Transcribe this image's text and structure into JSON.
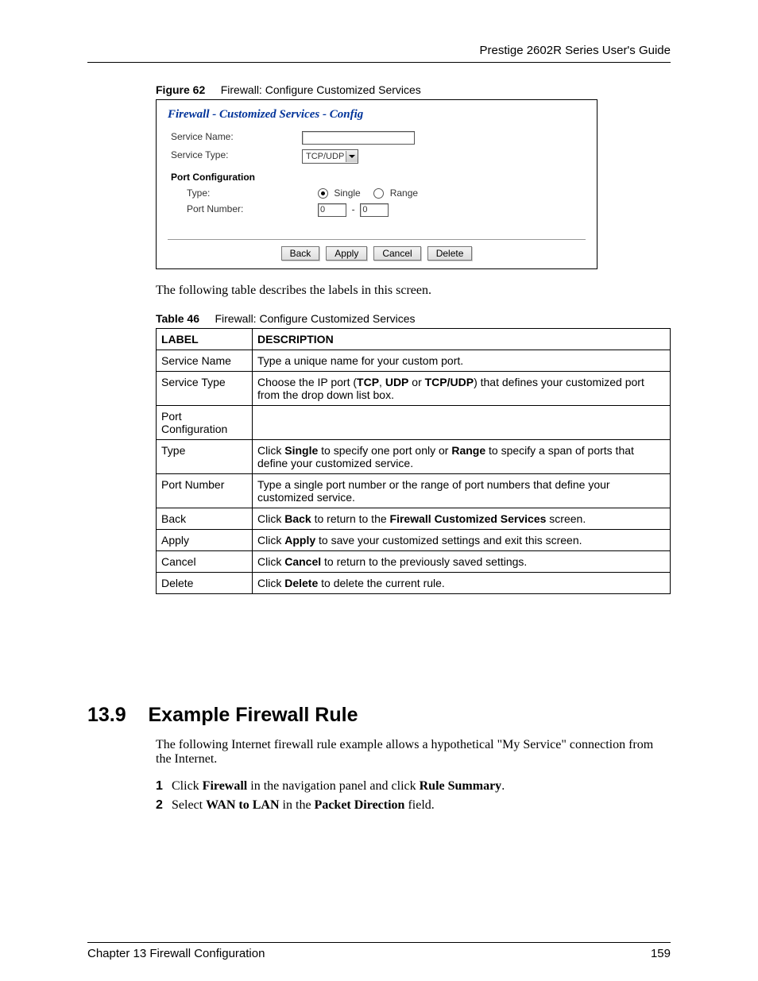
{
  "header": {
    "guide_title": "Prestige 2602R Series User's Guide"
  },
  "figure": {
    "label": "Figure 62",
    "title": "Firewall: Configure Customized Services",
    "panel_title": "Firewall - Customized Services - Config",
    "service_name_label": "Service Name:",
    "service_name_value": "",
    "service_type_label": "Service Type:",
    "service_type_value": "TCP/UDP",
    "port_config_heading": "Port Configuration",
    "type_label": "Type:",
    "type_single": "Single",
    "type_range": "Range",
    "port_number_label": "Port Number:",
    "port_from": "0",
    "port_dash": "-",
    "port_to": "0",
    "buttons": {
      "back": "Back",
      "apply": "Apply",
      "cancel": "Cancel",
      "delete": "Delete"
    }
  },
  "intro_text": "The following table describes the labels in this screen.",
  "table": {
    "label": "Table 46",
    "title": "Firewall: Configure Customized Services",
    "headers": {
      "label": "LABEL",
      "description": "DESCRIPTION"
    },
    "rows": [
      {
        "label": "Service Name",
        "desc_parts": [
          "Type a unique name for your custom port."
        ]
      },
      {
        "label": "Service Type",
        "desc_parts": [
          "Choose the IP port (",
          "TCP",
          ", ",
          "UDP",
          " or ",
          "TCP/UDP",
          ") that defines your customized port from the drop down list box."
        ],
        "bold_indices": [
          1,
          3,
          5
        ]
      },
      {
        "label": "Port Configuration",
        "desc_parts": [
          ""
        ]
      },
      {
        "label": "Type",
        "desc_parts": [
          "Click ",
          "Single",
          " to specify one port only or ",
          "Range",
          " to specify a span of ports that define your customized service."
        ],
        "bold_indices": [
          1,
          3
        ]
      },
      {
        "label": "Port Number",
        "desc_parts": [
          "Type a single port number or the range of port numbers that define your customized service."
        ]
      },
      {
        "label": "Back",
        "desc_parts": [
          "Click ",
          "Back",
          " to return to the ",
          "Firewall Customized Services",
          " screen."
        ],
        "bold_indices": [
          1,
          3
        ]
      },
      {
        "label": "Apply",
        "desc_parts": [
          "Click ",
          "Apply",
          " to save your customized settings and exit this screen."
        ],
        "bold_indices": [
          1
        ]
      },
      {
        "label": "Cancel",
        "desc_parts": [
          "Click ",
          "Cancel",
          " to return to the previously saved settings."
        ],
        "bold_indices": [
          1
        ]
      },
      {
        "label": "Delete",
        "desc_parts": [
          "Click ",
          "Delete",
          " to delete the current rule."
        ],
        "bold_indices": [
          1
        ]
      }
    ]
  },
  "section": {
    "number": "13.9",
    "title": "Example Firewall Rule",
    "intro": "The following Internet firewall rule example allows a hypothetical \"My Service\" connection from the Internet.",
    "steps": [
      {
        "n": "1",
        "parts": [
          "Click ",
          "Firewall",
          " in the navigation panel and click ",
          "Rule Summary",
          "."
        ],
        "bold_indices": [
          1,
          3
        ]
      },
      {
        "n": "2",
        "parts": [
          "Select ",
          "WAN to LAN",
          " in the ",
          "Packet Direction",
          " field."
        ],
        "bold_indices": [
          1,
          3
        ]
      }
    ]
  },
  "footer": {
    "chapter": "Chapter 13 Firewall Configuration",
    "page": "159"
  }
}
